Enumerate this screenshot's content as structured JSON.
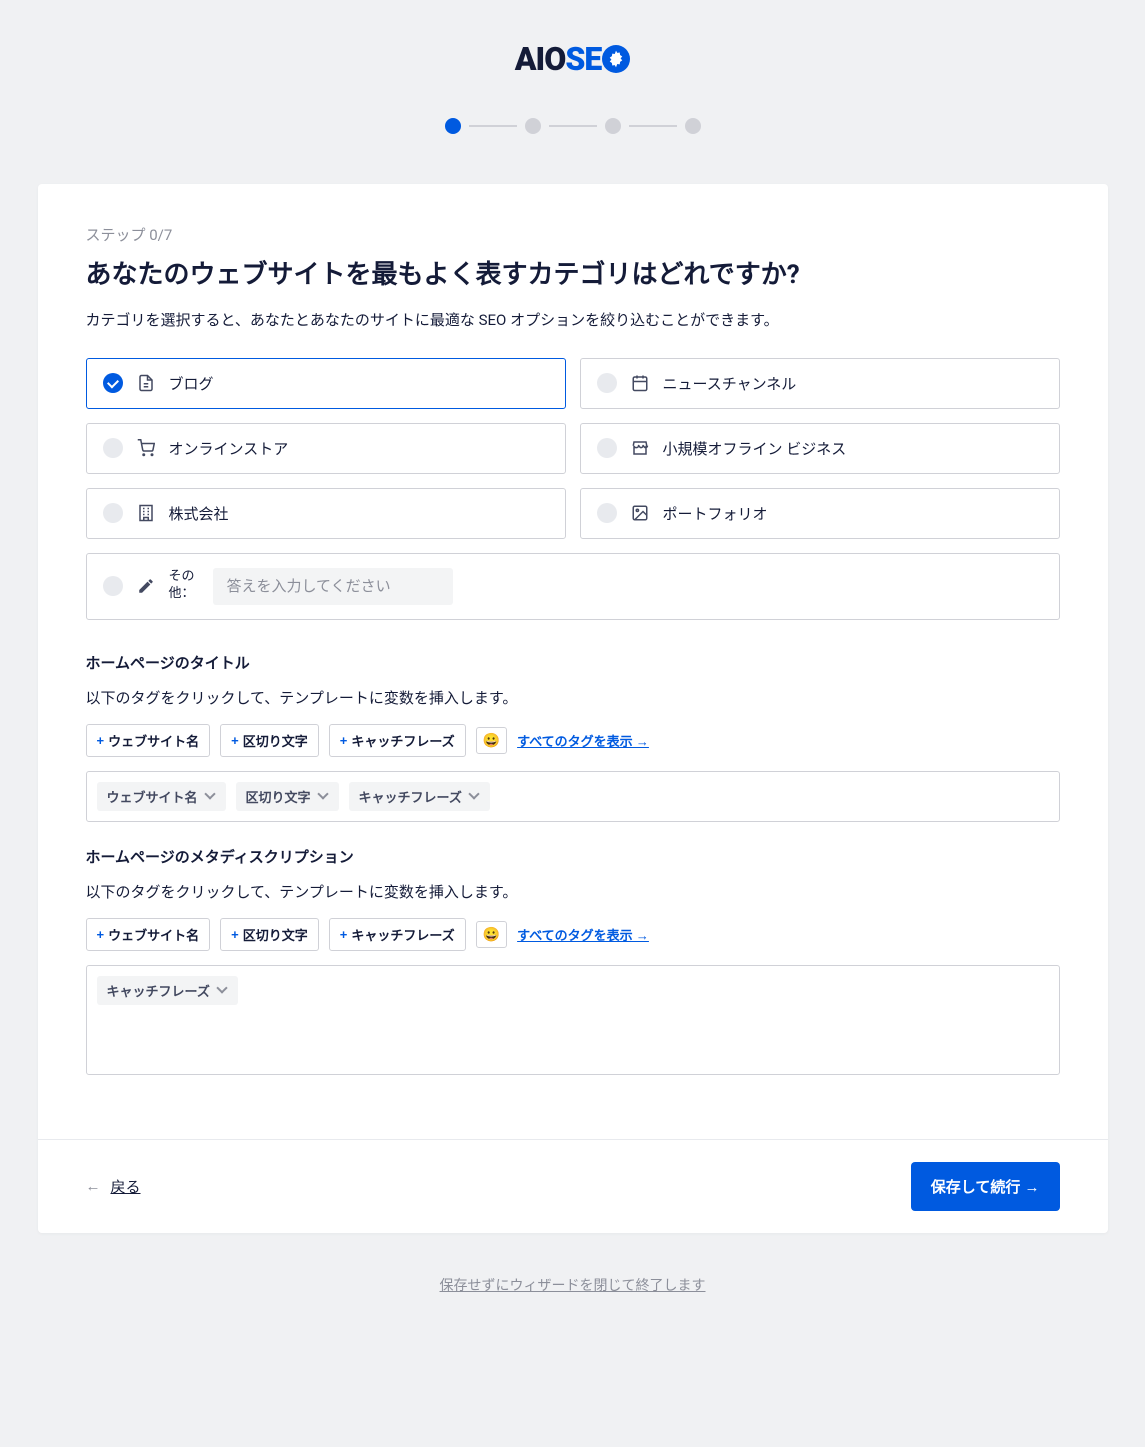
{
  "brand": {
    "aio": "AIO",
    "seo": "SE"
  },
  "progress": {
    "steps": [
      {
        "active": true
      },
      {
        "active": false
      },
      {
        "active": false
      },
      {
        "active": false
      }
    ]
  },
  "step_label": "ステップ 0/7",
  "page_title": "あなたのウェブサイトを最もよく表すカテゴリはどれですか?",
  "page_subtitle": "カテゴリを選択すると、あなたとあなたのサイトに最適な SEO オプションを絞り込むことができます。",
  "categories": [
    {
      "id": "blog",
      "label": "ブログ",
      "selected": true,
      "icon": "file-icon"
    },
    {
      "id": "news",
      "label": "ニュースチャンネル",
      "selected": false,
      "icon": "calendar-icon"
    },
    {
      "id": "store",
      "label": "オンラインストア",
      "selected": false,
      "icon": "cart-icon"
    },
    {
      "id": "offline",
      "label": "小規模オフライン ビジネス",
      "selected": false,
      "icon": "storefront-icon"
    },
    {
      "id": "corp",
      "label": "株式会社",
      "selected": false,
      "icon": "building-icon"
    },
    {
      "id": "portfolio",
      "label": "ポートフォリオ",
      "selected": false,
      "icon": "image-icon"
    }
  ],
  "other": {
    "label": "その他：",
    "placeholder": "答えを入力してください"
  },
  "title_section": {
    "heading": "ホームページのタイトル",
    "subtitle": "以下のタグをクリックして、テンプレートに変数を挿入します。",
    "add_tags": [
      "ウェブサイト名",
      "区切り文字",
      "キャッチフレーズ"
    ],
    "emoji": "😀",
    "show_all": "すべてのタグを表示 →",
    "value_tags": [
      "ウェブサイト名",
      "区切り文字",
      "キャッチフレーズ"
    ]
  },
  "meta_section": {
    "heading": "ホームページのメタディスクリプション",
    "subtitle": "以下のタグをクリックして、テンプレートに変数を挿入します。",
    "add_tags": [
      "ウェブサイト名",
      "区切り文字",
      "キャッチフレーズ"
    ],
    "emoji": "😀",
    "show_all": "すべてのタグを表示 →",
    "value_tags": [
      "キャッチフレーズ"
    ]
  },
  "footer": {
    "back_arrow": "←",
    "back": "戻る",
    "continue": "保存して続行 →"
  },
  "exit_link": "保存せずにウィザードを閉じて終了します"
}
